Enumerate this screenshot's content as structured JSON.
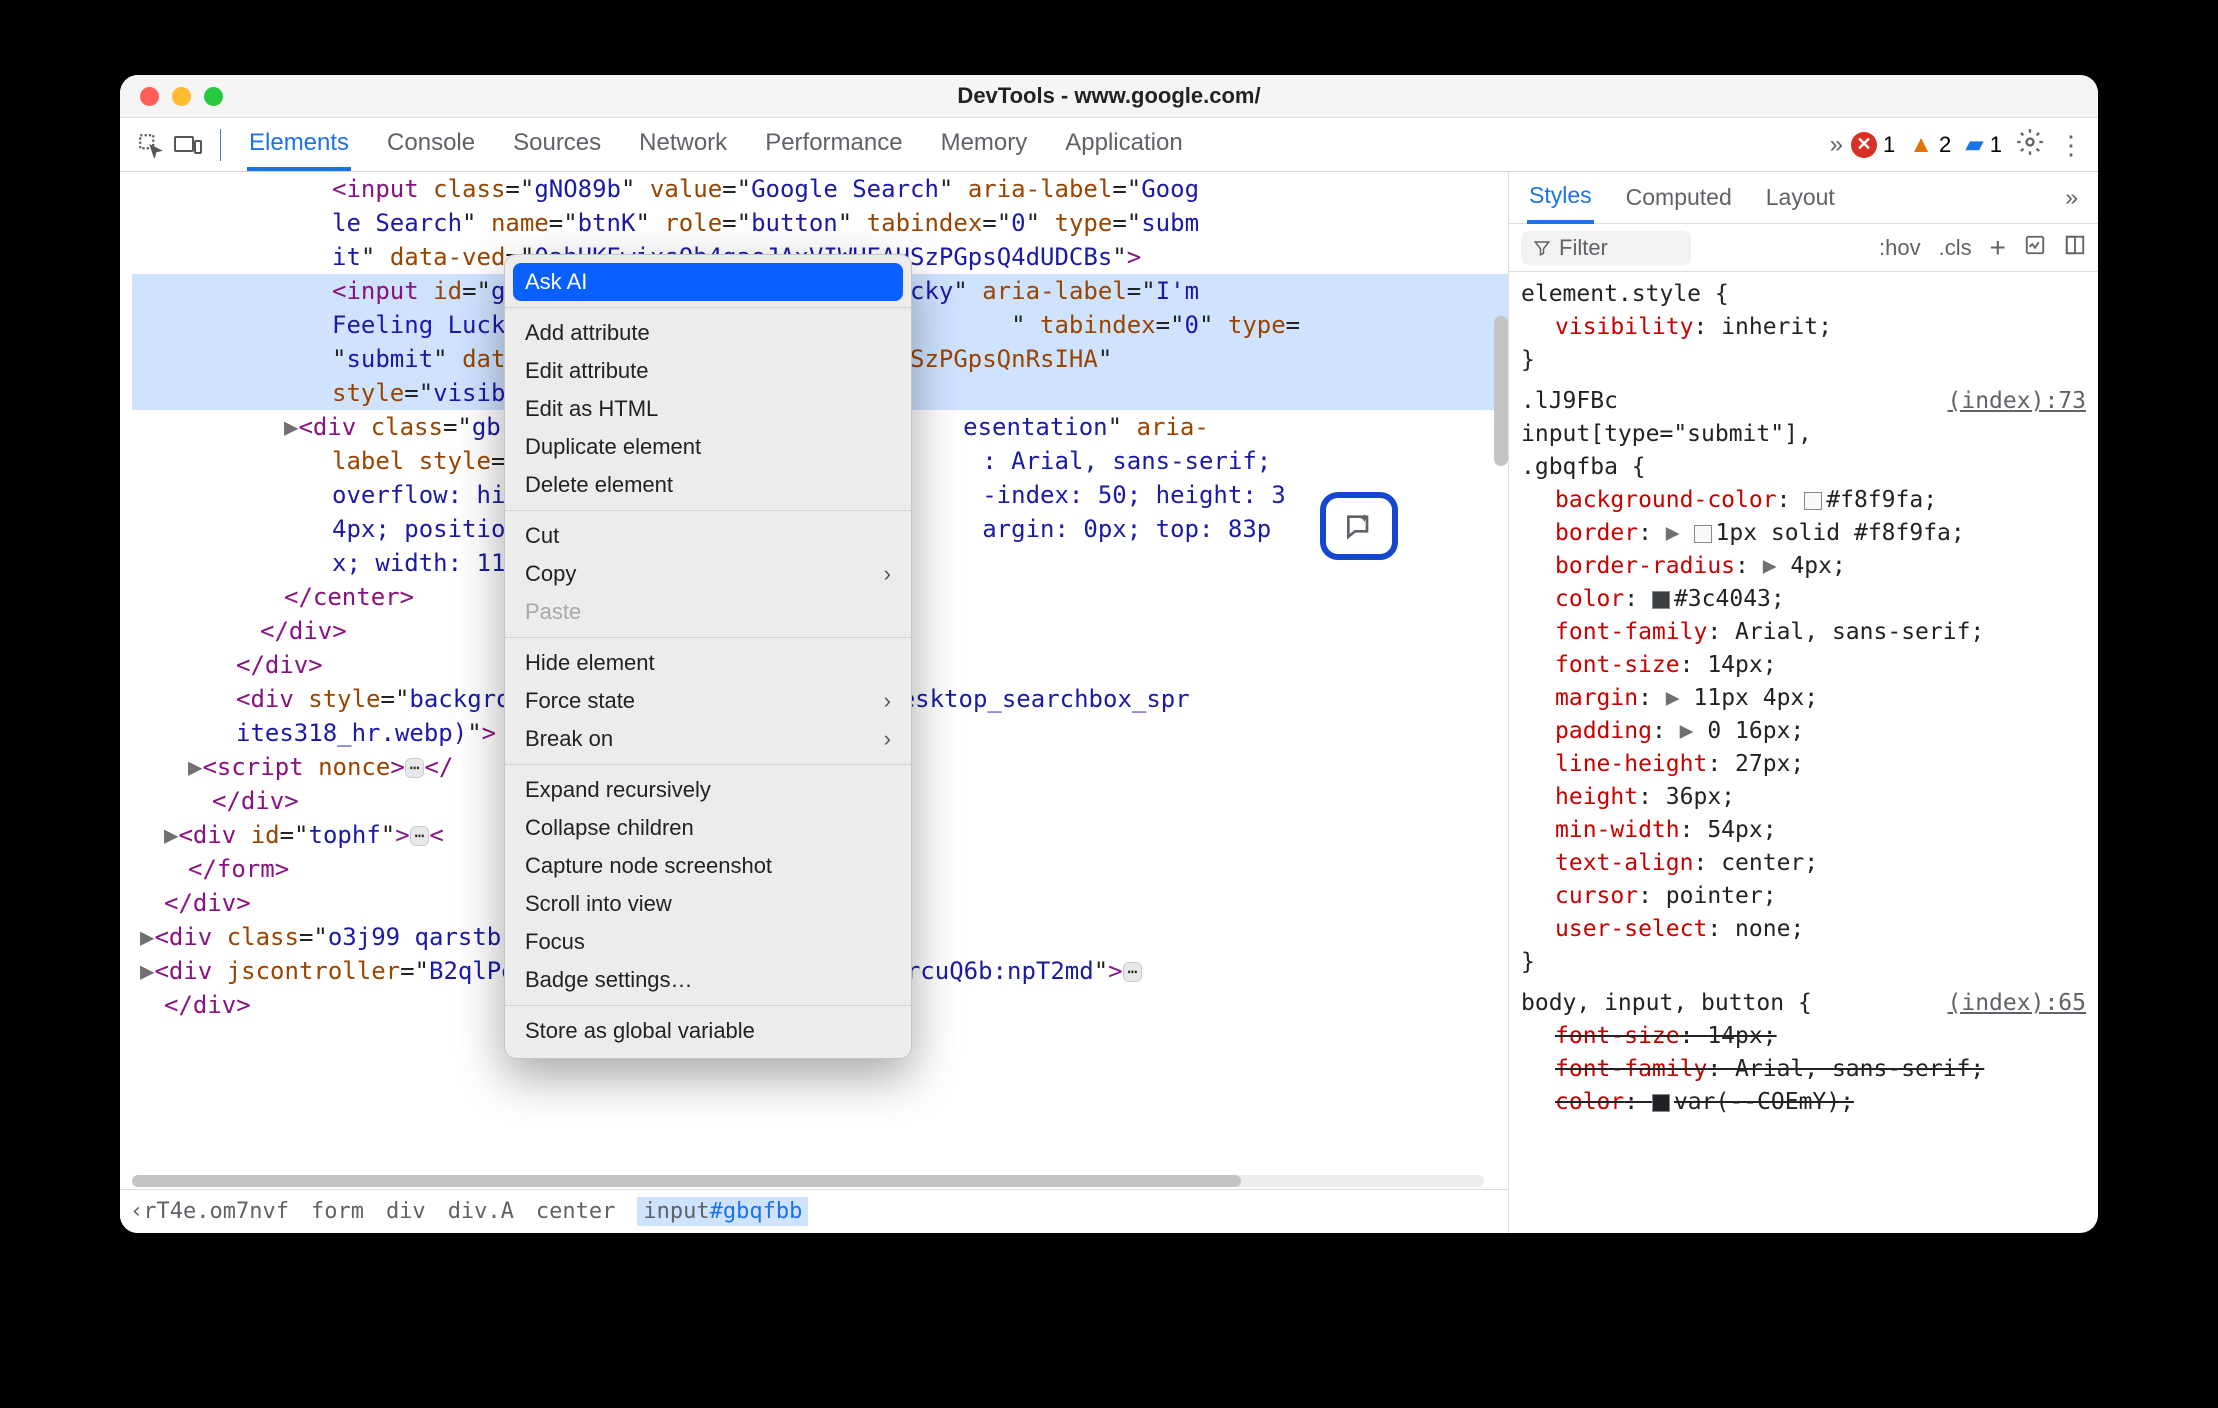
{
  "window": {
    "title": "DevTools - www.google.com/"
  },
  "toolbar": {
    "tabs": [
      "Elements",
      "Console",
      "Sources",
      "Network",
      "Performance",
      "Memory",
      "Application"
    ],
    "active_tab": 0,
    "overflow": "»",
    "errors": {
      "count": "1"
    },
    "warnings": {
      "count": "2"
    },
    "issues": {
      "count": "1"
    }
  },
  "dom": {
    "lines": [
      {
        "indent": 200,
        "html": "<span class='t'>&lt;input</span> <span class='a'>class</span>=\"<span class='v'>gNO89b</span>\" <span class='a'>value</span>=\"<span class='v'>Google Search</span>\" <span class='a'>aria-label</span>=\"<span class='v'>Goog</span>"
      },
      {
        "indent": 200,
        "html": "<span class='v'>le Search</span>\" <span class='a'>name</span>=\"<span class='v'>btnK</span>\" <span class='a'>role</span>=\"<span class='v'>button</span>\" <span class='a'>tabindex</span>=\"<span class='v'>0</span>\" <span class='a'>type</span>=\"<span class='v'>subm</span>"
      },
      {
        "indent": 200,
        "html": "<span class='v'>it</span>\" <span class='a'>data-ved</span>=\"<span class='v'>0ahUKEwixsOb4gaeJAxVIWUEAHSzPGpsQ4dUDCBs</span>\"<span class='t'>&gt;</span>"
      },
      {
        "indent": 200,
        "sel": true,
        "html": "<span class='t'>&lt;input</span> <span class='a'>id</span>=\"<span class='v'>gbqfbb</span>\" <span class='a'>value</span>=\"<span class='v'>I'm Feeling Lucky</span>\" <span class='a'>aria-label</span>=\"<span class='v'>I'm </span>"
      },
      {
        "indent": 200,
        "sel": true,
        "html": "<span class='v'>Feeling Lucky</span>\"&nbsp;&nbsp;&nbsp;&nbsp;&nbsp;&nbsp;&nbsp;&nbsp;&nbsp;&nbsp;&nbsp;&nbsp;&nbsp;&nbsp;&nbsp;&nbsp;&nbsp;&nbsp;&nbsp;&nbsp;&nbsp;&nbsp;&nbsp;&nbsp;&nbsp;&nbsp;&nbsp;&nbsp;&nbsp;&nbsp;&nbsp;&nbsp;&nbsp;\" <span class='a'>tabindex</span>=\"<span class='v'>0</span>\" <span class='a'>type</span>="
      },
      {
        "indent": 200,
        "sel": true,
        "html": "\"<span class='v'>submit</span>\" <span class='a'>data-                    IWUEAHSzPGpsQnRsIHA</span>\" "
      },
      {
        "indent": 200,
        "sel": true,
        "html": "<span class='a'>style</span>=\"<span class='v'>visibil</span>"
      },
      {
        "indent": 176,
        "caret": true,
        "html": "<span class='t'>&lt;div</span> <span class='a'>class</span>=\"<span class='v'>gb</span>&nbsp;&nbsp;&nbsp;&nbsp;&nbsp;&nbsp;&nbsp;&nbsp;&nbsp;&nbsp;&nbsp;&nbsp;&nbsp;&nbsp;&nbsp;&nbsp;&nbsp;&nbsp;&nbsp;&nbsp;&nbsp;&nbsp;&nbsp;&nbsp;&nbsp;&nbsp;&nbsp;&nbsp;&nbsp;&nbsp;&nbsp;&nbsp;<span class='v'>esentation</span>\" <span class='a'>aria-</span>"
      },
      {
        "indent": 200,
        "html": "<span class='a'>label style</span>=\"<span class='v'>d</span>&nbsp;&nbsp;&nbsp;&nbsp;&nbsp;&nbsp;&nbsp;&nbsp;&nbsp;&nbsp;&nbsp;&nbsp;&nbsp;&nbsp;&nbsp;&nbsp;&nbsp;&nbsp;&nbsp;&nbsp;&nbsp;&nbsp;&nbsp;&nbsp;&nbsp;&nbsp;&nbsp;&nbsp;&nbsp;&nbsp;&nbsp;<span class='v'>: Arial, sans-serif; </span>"
      },
      {
        "indent": 200,
        "html": "<span class='v'>overflow: hidd</span>&nbsp;&nbsp;&nbsp;&nbsp;&nbsp;&nbsp;&nbsp;&nbsp;&nbsp;&nbsp;&nbsp;&nbsp;&nbsp;&nbsp;&nbsp;&nbsp;&nbsp;&nbsp;&nbsp;&nbsp;&nbsp;&nbsp;&nbsp;&nbsp;&nbsp;&nbsp;&nbsp;&nbsp;&nbsp;&nbsp;&nbsp;<span class='v'>-index: 50; height: 3</span>"
      },
      {
        "indent": 200,
        "html": "<span class='v'>4px; position:</span>&nbsp;&nbsp;&nbsp;&nbsp;&nbsp;&nbsp;&nbsp;&nbsp;&nbsp;&nbsp;&nbsp;&nbsp;&nbsp;&nbsp;&nbsp;&nbsp;&nbsp;&nbsp;&nbsp;&nbsp;&nbsp;&nbsp;&nbsp;&nbsp;&nbsp;&nbsp;&nbsp;&nbsp;&nbsp;&nbsp;&nbsp;<span class='v'>argin: 0px; top: 83p</span>"
      },
      {
        "indent": 200,
        "html": "<span class='v'>x; width: 111p</span>"
      },
      {
        "indent": 152,
        "html": "<span class='t'>&lt;/center&gt;</span>"
      },
      {
        "indent": 128,
        "html": "<span class='t'>&lt;/div&gt;</span>"
      },
      {
        "indent": 104,
        "html": "<span class='t'>&lt;/div&gt;</span>"
      },
      {
        "indent": 104,
        "html": "<span class='t'>&lt;div</span> <span class='a'>style</span>=\"<span class='v'>backgro</span>&nbsp;&nbsp;&nbsp;&nbsp;&nbsp;&nbsp;&nbsp;&nbsp;&nbsp;&nbsp;&nbsp;&nbsp;&nbsp;&nbsp;&nbsp;&nbsp;&nbsp;&nbsp;&nbsp;&nbsp;&nbsp;&nbsp;&nbsp;&nbsp;&nbsp;&nbsp;<span class='v'>desktop_searchbox_spr</span>"
      },
      {
        "indent": 104,
        "html": "<span class='v'>ites318_hr.webp)</span>\"<span class='t'>&gt;</span> ·"
      },
      {
        "indent": 80,
        "caret": true,
        "html": "<span class='t'>&lt;script</span> <span class='a'>nonce</span><span class='t'>&gt;</span><span class='dots'>⋯</span><span class='t'>&lt;/</span>"
      },
      {
        "indent": 80,
        "html": "<span class='t'>&lt;/div&gt;</span>"
      },
      {
        "indent": 56,
        "caret": true,
        "html": "<span class='t'>&lt;div</span> <span class='a'>id</span>=\"<span class='v'>tophf</span>\"<span class='t'>&gt;</span><span class='dots'>⋯</span><span class='t'>&lt;</span>"
      },
      {
        "indent": 56,
        "html": "<span class='t'>&lt;/form&gt;</span>"
      },
      {
        "indent": 32,
        "html": "<span class='t'>&lt;/div&gt;</span>"
      },
      {
        "indent": 32,
        "caret": true,
        "html": "<span class='t'>&lt;div</span> <span class='a'>class</span>=\"<span class='v'>o3j99 qarstb</span>"
      },
      {
        "indent": 32,
        "caret": true,
        "html": "<span class='t'>&lt;div</span> <span class='a'>jscontroller</span>=\"<span class='v'>B2qlPe</span>&nbsp;&nbsp;&nbsp;&nbsp;&nbsp;&nbsp;&nbsp;&nbsp;&nbsp;&nbsp;&nbsp;&nbsp;&nbsp;&nbsp;&nbsp;&nbsp;&nbsp;&nbsp;&nbsp;&nbsp;&nbsp;&nbsp;&nbsp;&nbsp;<span class='a'>n</span>=\"<span class='v'>rcuQ6b:npT2md</span>\"<span class='t'>&gt;</span><span class='dots'>⋯</span>"
      },
      {
        "indent": 32,
        "html": "<span class='t'>&lt;/div&gt;</span>"
      }
    ]
  },
  "breadcrumb": {
    "items": [
      "‹rT4e.om7nvf",
      "form",
      "div",
      "div.A",
      "center"
    ],
    "selected": "input",
    "selected_id": "#gbqfbb"
  },
  "context_menu": {
    "items": [
      {
        "label": "Ask AI",
        "hi": true
      },
      {
        "sep": true
      },
      {
        "label": "Add attribute"
      },
      {
        "label": "Edit attribute"
      },
      {
        "label": "Edit as HTML"
      },
      {
        "label": "Duplicate element"
      },
      {
        "label": "Delete element"
      },
      {
        "sep": true
      },
      {
        "label": "Cut"
      },
      {
        "label": "Copy",
        "sub": true
      },
      {
        "label": "Paste",
        "dis": true
      },
      {
        "sep": true
      },
      {
        "label": "Hide element"
      },
      {
        "label": "Force state",
        "sub": true
      },
      {
        "label": "Break on",
        "sub": true
      },
      {
        "sep": true
      },
      {
        "label": "Expand recursively"
      },
      {
        "label": "Collapse children"
      },
      {
        "label": "Capture node screenshot"
      },
      {
        "label": "Scroll into view"
      },
      {
        "label": "Focus"
      },
      {
        "label": "Badge settings…"
      },
      {
        "sep": true
      },
      {
        "label": "Store as global variable"
      }
    ]
  },
  "styles_panel": {
    "tabs": [
      "Styles",
      "Computed",
      "Layout"
    ],
    "overflow": "»",
    "filter_placeholder": "Filter",
    "toggles": [
      ":hov",
      ".cls"
    ],
    "rules": [
      {
        "selector": "element.style {",
        "src": "",
        "decls": [
          {
            "prop": "visibility",
            "val": "inherit;"
          }
        ],
        "close": "}"
      },
      {
        "selector": ".lJ9FBc\ninput[type=\"submit\"],\n.gbqfba {",
        "src": "(index):73",
        "decls": [
          {
            "prop": "background-color",
            "val": "#f8f9fa;",
            "swatch": "#f8f9fa"
          },
          {
            "prop": "border",
            "val": "1px solid #f8f9fa;",
            "tri": true,
            "swatch": "#f8f9fa"
          },
          {
            "prop": "border-radius",
            "val": "4px;",
            "tri": true
          },
          {
            "prop": "color",
            "val": "#3c4043;",
            "swatch": "#3c4043"
          },
          {
            "prop": "font-family",
            "val": "Arial, sans-serif;"
          },
          {
            "prop": "font-size",
            "val": "14px;"
          },
          {
            "prop": "margin",
            "val": "11px 4px;",
            "tri": true
          },
          {
            "prop": "padding",
            "val": "0 16px;",
            "tri": true
          },
          {
            "prop": "line-height",
            "val": "27px;"
          },
          {
            "prop": "height",
            "val": "36px;"
          },
          {
            "prop": "min-width",
            "val": "54px;"
          },
          {
            "prop": "text-align",
            "val": "center;"
          },
          {
            "prop": "cursor",
            "val": "pointer;"
          },
          {
            "prop": "user-select",
            "val": "none;"
          }
        ],
        "close": "}"
      },
      {
        "selector": "body, input, button {",
        "src": "(index):65",
        "decls": [
          {
            "prop": "font-size",
            "val": "14px;",
            "strike": true
          },
          {
            "prop": "font-family",
            "val": "Arial, sans-serif;",
            "strike": true
          },
          {
            "prop": "color",
            "val": "var(--COEmY);",
            "strike": true,
            "swatch": "#202124"
          }
        ]
      }
    ]
  }
}
